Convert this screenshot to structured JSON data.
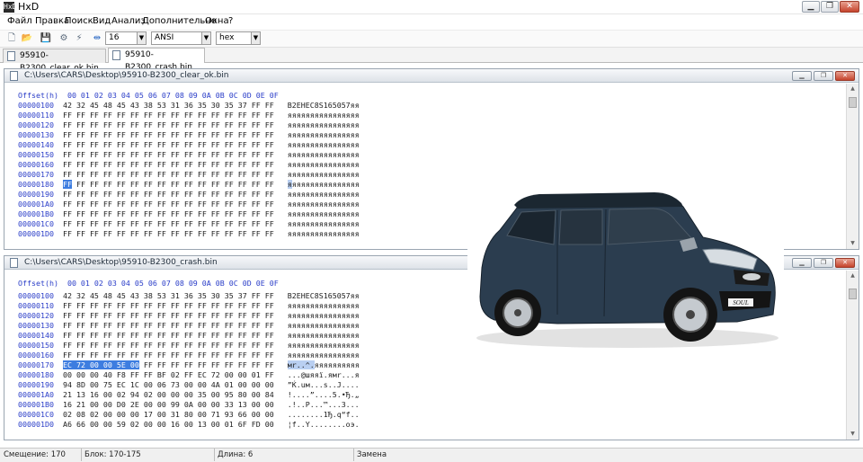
{
  "window": {
    "app_icon": "HxD",
    "title": "HxD"
  },
  "menu": [
    "Файл",
    "Правка",
    "Поиск",
    "Вид",
    "Анализ",
    "Дополнительно",
    "Окна",
    "?"
  ],
  "toolbar": {
    "icons": [
      "new-file-icon",
      "open-file-icon",
      "save-icon",
      "tools-icon",
      "flash-icon",
      "columns-icon"
    ],
    "bytes_per_row": "16",
    "charset": "ANSI",
    "offset_base": "hex"
  },
  "tabs": [
    {
      "label": "95910-B2300_clear_ok.bin",
      "active": false
    },
    {
      "label": "95910-B2300_crash.bin",
      "active": true
    }
  ],
  "column_header": "Offset(h)  00 01 02 03 04 05 06 07 08 09 0A 0B 0C 0D 0E 0F",
  "editors": [
    {
      "path": "C:\\Users\\CARS\\Desktop\\95910-B2300_clear_ok.bin",
      "rows": [
        {
          "offset": "00000100",
          "hex": "42 32 45 48 45 43 38 53 31 36 35 30 35 37 FF FF",
          "ascii": "B2EHEC8S165057яя"
        },
        {
          "offset": "00000110",
          "hex": "FF FF FF FF FF FF FF FF FF FF FF FF FF FF FF FF",
          "ascii": "яяяяяяяяяяяяяяяя"
        },
        {
          "offset": "00000120",
          "hex": "FF FF FF FF FF FF FF FF FF FF FF FF FF FF FF FF",
          "ascii": "яяяяяяяяяяяяяяяя"
        },
        {
          "offset": "00000130",
          "hex": "FF FF FF FF FF FF FF FF FF FF FF FF FF FF FF FF",
          "ascii": "яяяяяяяяяяяяяяяя"
        },
        {
          "offset": "00000140",
          "hex": "FF FF FF FF FF FF FF FF FF FF FF FF FF FF FF FF",
          "ascii": "яяяяяяяяяяяяяяяя"
        },
        {
          "offset": "00000150",
          "hex": "FF FF FF FF FF FF FF FF FF FF FF FF FF FF FF FF",
          "ascii": "яяяяяяяяяяяяяяяя"
        },
        {
          "offset": "00000160",
          "hex": "FF FF FF FF FF FF FF FF FF FF FF FF FF FF FF FF",
          "ascii": "яяяяяяяяяяяяяяяя"
        },
        {
          "offset": "00000170",
          "hex": "FF FF FF FF FF FF FF FF FF FF FF FF FF FF FF FF",
          "ascii": "яяяяяяяяяяяяяяяя"
        },
        {
          "offset": "00000180",
          "hex": "FF FF FF FF FF FF FF FF FF FF FF FF FF FF FF FF",
          "ascii": "яяяяяяяяяяяяяяяя",
          "cursor": true
        },
        {
          "offset": "00000190",
          "hex": "FF FF FF FF FF FF FF FF FF FF FF FF FF FF FF FF",
          "ascii": "яяяяяяяяяяяяяяяя"
        },
        {
          "offset": "000001A0",
          "hex": "FF FF FF FF FF FF FF FF FF FF FF FF FF FF FF FF",
          "ascii": "яяяяяяяяяяяяяяяя"
        },
        {
          "offset": "000001B0",
          "hex": "FF FF FF FF FF FF FF FF FF FF FF FF FF FF FF FF",
          "ascii": "яяяяяяяяяяяяяяяя"
        },
        {
          "offset": "000001C0",
          "hex": "FF FF FF FF FF FF FF FF FF FF FF FF FF FF FF FF",
          "ascii": "яяяяяяяяяяяяяяяя"
        },
        {
          "offset": "000001D0",
          "hex": "FF FF FF FF FF FF FF FF FF FF FF FF FF FF FF FF",
          "ascii": "яяяяяяяяяяяяяяяя"
        }
      ]
    },
    {
      "path": "C:\\Users\\CARS\\Desktop\\95910-B2300_crash.bin",
      "rows": [
        {
          "offset": "00000100",
          "hex": "42 32 45 48 45 43 38 53 31 36 35 30 35 37 FF FF",
          "ascii": "B2EHEC8S165057яя"
        },
        {
          "offset": "00000110",
          "hex": "FF FF FF FF FF FF FF FF FF FF FF FF FF FF FF FF",
          "ascii": "яяяяяяяяяяяяяяяя"
        },
        {
          "offset": "00000120",
          "hex": "FF FF FF FF FF FF FF FF FF FF FF FF FF FF FF FF",
          "ascii": "яяяяяяяяяяяяяяяя"
        },
        {
          "offset": "00000130",
          "hex": "FF FF FF FF FF FF FF FF FF FF FF FF FF FF FF FF",
          "ascii": "яяяяяяяяяяяяяяяя"
        },
        {
          "offset": "00000140",
          "hex": "FF FF FF FF FF FF FF FF FF FF FF FF FF FF FF FF",
          "ascii": "яяяяяяяяяяяяяяяя"
        },
        {
          "offset": "00000150",
          "hex": "FF FF FF FF FF FF FF FF FF FF FF FF FF FF FF FF",
          "ascii": "яяяяяяяяяяяяяяяя"
        },
        {
          "offset": "00000160",
          "hex": "FF FF FF FF FF FF FF FF FF FF FF FF FF FF FF FF",
          "ascii": "яяяяяяяяяяяяяяяя"
        },
        {
          "offset": "00000170",
          "hex_sel": "EC 72 00 00 5E 00",
          "hex_rest": " FF FF FF FF FF FF FF FF FF FF",
          "ascii_sel": "мr..^.",
          "ascii_rest": "яяяяяяяяяя"
        },
        {
          "offset": "00000180",
          "hex": "00 00 00 40 F8 FF FF BF 02 FF EC 72 00 00 01 FF",
          "ascii": "...@шяяї.ямr...я"
        },
        {
          "offset": "00000190",
          "hex": "94 8D 00 75 EC 1C 00 06 73 00 00 4A 01 00 00 00",
          "ascii": "”Ќ.uм...s..J...."
        },
        {
          "offset": "000001A0",
          "hex": "21 13 16 00 02 94 02 00 00 00 35 00 95 80 00 84",
          "ascii": "!....”....5.•Ђ.„"
        },
        {
          "offset": "000001B0",
          "hex": "16 21 00 00 D0 2E 00 00 99 0A 00 00 33 13 00 00",
          "ascii": ".!..Р...™...3..."
        },
        {
          "offset": "000001C0",
          "hex": "02 08 02 00 00 00 17 00 31 80 00 71 93 66 00 00",
          "ascii": "........1Ђ.q“f.."
        },
        {
          "offset": "000001D0",
          "hex": "A6 66 00 00 59 02 00 00 16 00 13 00 01 6F FD 00",
          "ascii": "¦f..Y........oэ."
        }
      ]
    }
  ],
  "statusbar": {
    "offset": "Смещение: 170",
    "block": "Блок: 170-175",
    "length": "Длина: 6",
    "mode": "Замена"
  },
  "car": {
    "badge": "SOUL"
  }
}
